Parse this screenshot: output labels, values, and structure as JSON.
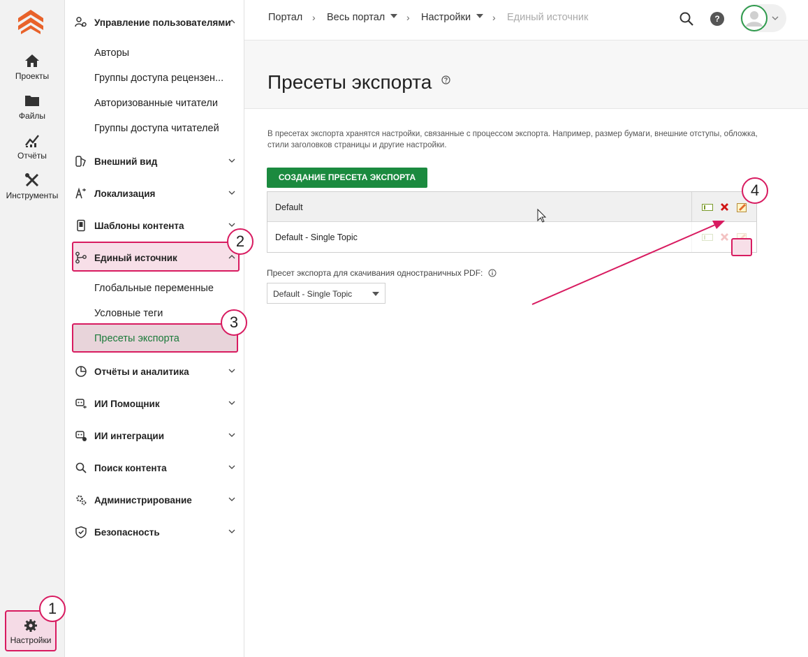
{
  "rail": {
    "items": [
      {
        "label": "Проекты",
        "icon": "home-icon"
      },
      {
        "label": "Файлы",
        "icon": "folder-icon"
      },
      {
        "label": "Отчёты",
        "icon": "chart-icon"
      },
      {
        "label": "Инструменты",
        "icon": "tools-icon"
      }
    ],
    "settings_label": "Настройки"
  },
  "menu": {
    "sections": [
      {
        "label": "Управление пользователями",
        "icon": "users-gear-icon",
        "expanded": true
      },
      {
        "label": "Внешний вид",
        "icon": "paint-icon"
      },
      {
        "label": "Локализация",
        "icon": "language-icon"
      },
      {
        "label": "Шаблоны контента",
        "icon": "template-icon"
      },
      {
        "label": "Единый источник",
        "icon": "branch-icon",
        "expanded": true,
        "active": true
      },
      {
        "label": "Отчёты и аналитика",
        "icon": "analytics-icon"
      },
      {
        "label": "ИИ Помощник",
        "icon": "ai-assistant-icon"
      },
      {
        "label": "ИИ интеграции",
        "icon": "ai-integration-icon"
      },
      {
        "label": "Поиск контента",
        "icon": "search-icon"
      },
      {
        "label": "Администрирование",
        "icon": "admin-icon"
      },
      {
        "label": "Безопасность",
        "icon": "shield-icon"
      }
    ],
    "users_sub": [
      "Авторы",
      "Группы доступа рецензен...",
      "Авторизованные читатели",
      "Группы доступа читателей"
    ],
    "single_source_sub": [
      "Глобальные переменные",
      "Условные теги",
      "Пресеты экспорта"
    ]
  },
  "breadcrumb": [
    "Портал",
    "Весь портал",
    "Настройки",
    "Единый источник"
  ],
  "header": {
    "help": "?"
  },
  "page": {
    "title": "Пресеты экспорта",
    "description": "В пресетах экспорта хранятся настройки, связанные с процессом экспорта. Например, размер бумаги, внешние отступы, обложка, стили заголовков страницы и другие настройки.",
    "create_button": "СОЗДАНИЕ ПРЕСЕТА ЭКСПОРТА",
    "presets": [
      {
        "name": "Default"
      },
      {
        "name": "Default - Single Topic"
      }
    ],
    "pdf_label": "Пресет экспорта для скачивания одностраничных PDF:",
    "pdf_selected": "Default - Single Topic"
  },
  "badges": [
    "1",
    "2",
    "3",
    "4"
  ],
  "colors": {
    "accent": "#d81b60",
    "brand_green": "#1b8a3f",
    "logo": "#e8622a"
  }
}
